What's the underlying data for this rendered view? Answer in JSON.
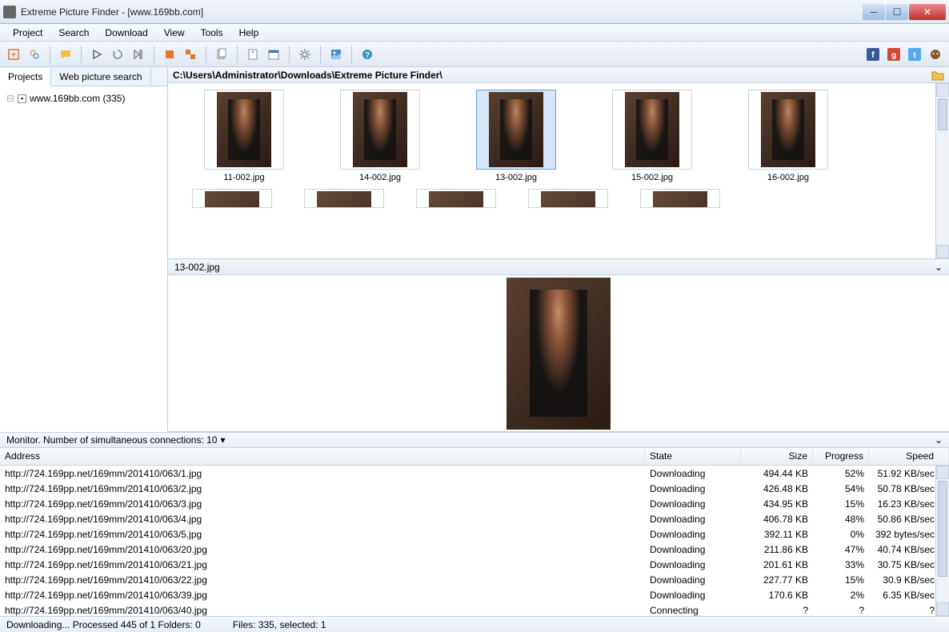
{
  "window": {
    "title": "Extreme Picture Finder - [www.169bb.com]"
  },
  "menu": [
    "Project",
    "Search",
    "Download",
    "View",
    "Tools",
    "Help"
  ],
  "sidebar": {
    "tabs": [
      "Projects",
      "Web picture search"
    ],
    "tree_item": "www.169bb.com (335)"
  },
  "path": "C:\\Users\\Administrator\\Downloads\\Extreme Picture Finder\\",
  "thumbs": [
    {
      "label": "11-002.jpg"
    },
    {
      "label": "14-002.jpg"
    },
    {
      "label": "13-002.jpg",
      "selected": true
    },
    {
      "label": "15-002.jpg"
    },
    {
      "label": "16-002.jpg"
    }
  ],
  "preview_name": "13-002.jpg",
  "monitor": {
    "label": "Monitor. Number of simultaneous connections: 10"
  },
  "dl_headers": {
    "address": "Address",
    "state": "State",
    "size": "Size",
    "progress": "Progress",
    "speed": "Speed"
  },
  "downloads": [
    {
      "addr": "http://724.169pp.net/169mm/201410/063/1.jpg",
      "state": "Downloading",
      "size": "494.44 KB",
      "prog": "52%",
      "speed": "51.92 KB/sec"
    },
    {
      "addr": "http://724.169pp.net/169mm/201410/063/2.jpg",
      "state": "Downloading",
      "size": "426.48 KB",
      "prog": "54%",
      "speed": "50.78 KB/sec"
    },
    {
      "addr": "http://724.169pp.net/169mm/201410/063/3.jpg",
      "state": "Downloading",
      "size": "434.95 KB",
      "prog": "15%",
      "speed": "16.23 KB/sec"
    },
    {
      "addr": "http://724.169pp.net/169mm/201410/063/4.jpg",
      "state": "Downloading",
      "size": "406.78 KB",
      "prog": "48%",
      "speed": "50.86 KB/sec"
    },
    {
      "addr": "http://724.169pp.net/169mm/201410/063/5.jpg",
      "state": "Downloading",
      "size": "392.11 KB",
      "prog": "0%",
      "speed": "392 bytes/sec"
    },
    {
      "addr": "http://724.169pp.net/169mm/201410/063/20.jpg",
      "state": "Downloading",
      "size": "211.86 KB",
      "prog": "47%",
      "speed": "40.74 KB/sec"
    },
    {
      "addr": "http://724.169pp.net/169mm/201410/063/21.jpg",
      "state": "Downloading",
      "size": "201.61 KB",
      "prog": "33%",
      "speed": "30.75 KB/sec"
    },
    {
      "addr": "http://724.169pp.net/169mm/201410/063/22.jpg",
      "state": "Downloading",
      "size": "227.77 KB",
      "prog": "15%",
      "speed": "30.9 KB/sec"
    },
    {
      "addr": "http://724.169pp.net/169mm/201410/063/39.jpg",
      "state": "Downloading",
      "size": "170.6 KB",
      "prog": "2%",
      "speed": "6.35 KB/sec"
    },
    {
      "addr": "http://724.169pp.net/169mm/201410/063/40.jpg",
      "state": "Connecting",
      "size": "?",
      "prog": "?",
      "speed": "?"
    }
  ],
  "status": {
    "left": "Downloading... Processed 445 of 1 Folders: 0",
    "right": "Files: 335, selected: 1"
  }
}
